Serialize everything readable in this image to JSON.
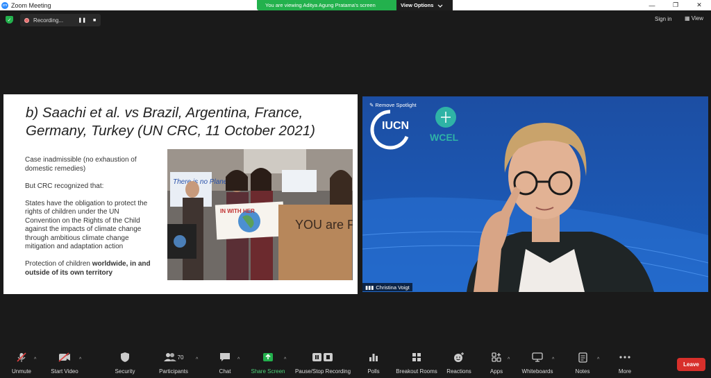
{
  "window": {
    "title": "Zoom Meeting",
    "controls": [
      "—",
      "❐",
      "✕"
    ]
  },
  "banner": {
    "message": "You are viewing Aditya Agung Pratama's screen",
    "options": "View Options"
  },
  "recording": {
    "label": "Recording...",
    "pause": "❚❚",
    "stop": "■"
  },
  "top_right": {
    "signin": "Sign in",
    "view": "View"
  },
  "slide": {
    "title": "b) Saachi et al. vs Brazil, Argentina, France, Germany, Turkey (UN CRC, 11 October 2021)",
    "para1": "Case inadmissible (no exhaustion of domestic remedies)",
    "para2": "But CRC recognized that:",
    "para3": "States have the obligation to protect the rights of children under the UN Convention on the Rights of the Child against the impacts of climate change through ambitious climate change mitigation and adaptation action",
    "para4_plain": "Protection of children ",
    "para4_bold": "worldwide, in and outside of its own territory",
    "photo_signs": [
      "There is no Planet B",
      "IN WITH HER",
      "YOU are FAILING US"
    ]
  },
  "speaker": {
    "spotlight": "Remove Spotlight",
    "name": "Christina Voigt",
    "logo1": "IUCN",
    "logo2": "WCEL"
  },
  "toolbar": {
    "items": [
      {
        "label": "Unmute",
        "icon": "mic-muted-icon"
      },
      {
        "label": "Start Video",
        "icon": "video-off-icon"
      },
      {
        "label": "Security",
        "icon": "shield-icon"
      },
      {
        "label": "Participants",
        "icon": "participants-icon",
        "count": "70"
      },
      {
        "label": "Chat",
        "icon": "chat-icon"
      },
      {
        "label": "Share Screen",
        "icon": "share-screen-icon"
      },
      {
        "label": "Pause/Stop Recording",
        "icon": "pause-stop-icon"
      },
      {
        "label": "Polls",
        "icon": "polls-icon"
      },
      {
        "label": "Breakout Rooms",
        "icon": "breakout-rooms-icon"
      },
      {
        "label": "Reactions",
        "icon": "reactions-icon"
      },
      {
        "label": "Apps",
        "icon": "apps-icon"
      },
      {
        "label": "Whiteboards",
        "icon": "whiteboard-icon"
      },
      {
        "label": "Notes",
        "icon": "notes-icon"
      },
      {
        "label": "More",
        "icon": "more-icon"
      }
    ],
    "leave": "Leave"
  },
  "colors": {
    "accent_green": "#23b14d",
    "leave_red": "#d8302b",
    "zoom_blue": "#2d8cff"
  }
}
